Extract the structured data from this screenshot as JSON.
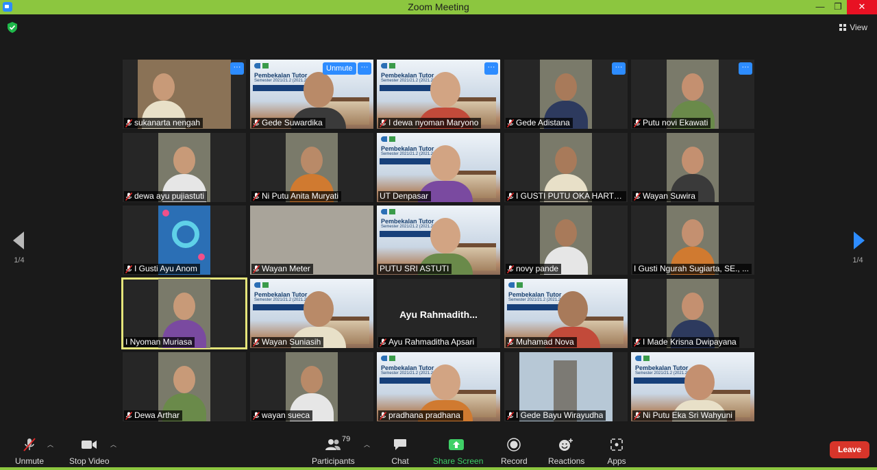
{
  "window": {
    "title": "Zoom Meeting",
    "min_glyph": "—",
    "max_glyph": "❐",
    "close_glyph": "✕"
  },
  "top_right": {
    "view_label": "View"
  },
  "pagination": {
    "left": "1/4",
    "right": "1/4"
  },
  "colors": {
    "titlebar": "#8cc63f",
    "accent": "#2d8cff",
    "leave": "#d8352a",
    "active_speaker": "#e5e57a"
  },
  "participants": [
    {
      "name": "sukanarta nengah",
      "muted": true,
      "video": "person",
      "more": true
    },
    {
      "name": "Gede Suwardika",
      "muted": true,
      "video": "slide",
      "more": true,
      "unmute": "Unmute"
    },
    {
      "name": "I dewa nyoman Maryono",
      "muted": true,
      "video": "slide",
      "more": true
    },
    {
      "name": "Gede Adistana",
      "muted": true,
      "video": "person",
      "more": true
    },
    {
      "name": "Putu novi Ekawati",
      "muted": true,
      "video": "person",
      "more": true
    },
    {
      "name": "dewa ayu pujiastuti",
      "muted": true,
      "video": "person"
    },
    {
      "name": "Ni Putu Anita Muryati",
      "muted": true,
      "video": "person"
    },
    {
      "name": "UT Denpasar",
      "muted": false,
      "video": "slide"
    },
    {
      "name": "I GUSTI PUTU OKA HARTO...",
      "muted": true,
      "video": "person"
    },
    {
      "name": "Wayan Suwira",
      "muted": true,
      "video": "person"
    },
    {
      "name": "I Gusti Ayu Anom",
      "muted": true,
      "video": "avatar"
    },
    {
      "name": "Wayan Meter",
      "muted": true,
      "video": "wall"
    },
    {
      "name": "PUTU SRI ASTUTI",
      "muted": false,
      "video": "slide"
    },
    {
      "name": "novy pande",
      "muted": true,
      "video": "person"
    },
    {
      "name": "I Gusti Ngurah Sugiarta, SE., ...",
      "muted": false,
      "video": "person"
    },
    {
      "name": "I Nyoman Muriasa",
      "muted": false,
      "video": "person",
      "active": true
    },
    {
      "name": "Wayan Suniasih",
      "muted": true,
      "video": "slide"
    },
    {
      "name": "Ayu Rahmaditha Apsari",
      "muted": true,
      "video": "none",
      "display": "Ayu  Rahmadith..."
    },
    {
      "name": "Muhamad Nova",
      "muted": true,
      "video": "slide"
    },
    {
      "name": "I Made Krisna Dwipayana",
      "muted": true,
      "video": "person"
    },
    {
      "name": "Dewa Arthar",
      "muted": true,
      "video": "person"
    },
    {
      "name": "wayan sueca",
      "muted": true,
      "video": "person"
    },
    {
      "name": "pradhana pradhana",
      "muted": true,
      "video": "slide"
    },
    {
      "name": "I Gede Bayu Wirayudha",
      "muted": true,
      "video": "room"
    },
    {
      "name": "Ni Putu Eka Sri Wahyuni",
      "muted": true,
      "video": "slide"
    }
  ],
  "slide_text": {
    "line1": "Pembekalan Tutor",
    "line2": "Semester 2021/21.2 (2021.2)",
    "line3": "UNIVERSITAS TERBUKA DENPASAR"
  },
  "toolbar": {
    "unmute": "Unmute",
    "stop_video": "Stop Video",
    "participants": "Participants",
    "participants_count": "79",
    "chat": "Chat",
    "share_screen": "Share Screen",
    "record": "Record",
    "reactions": "Reactions",
    "apps": "Apps",
    "leave": "Leave"
  }
}
